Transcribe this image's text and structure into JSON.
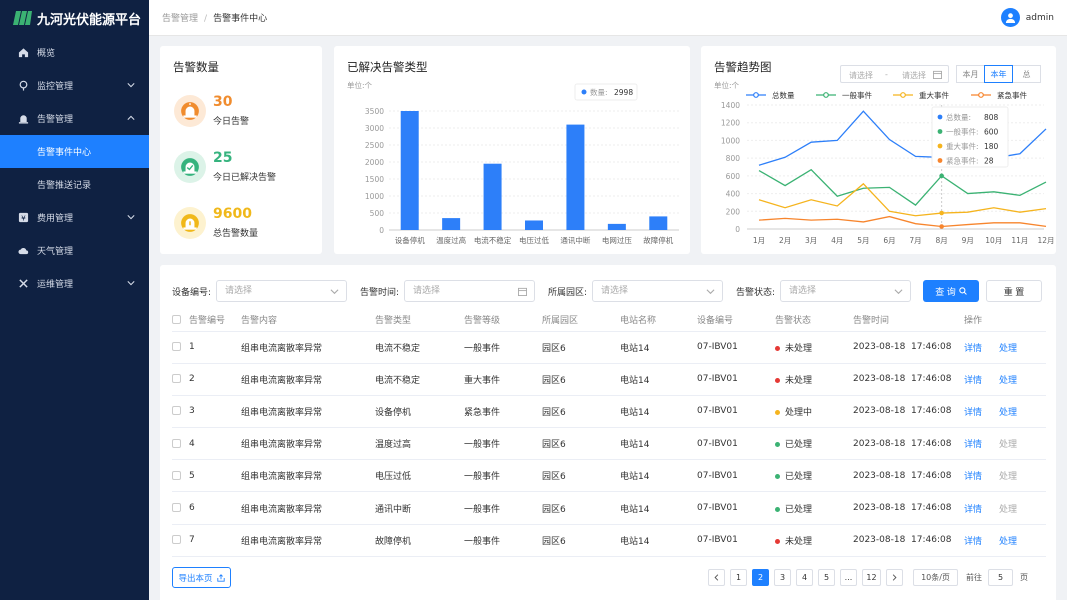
{
  "app": {
    "title": "九河光伏能源平台"
  },
  "sidebar": {
    "items": [
      {
        "label": "概览",
        "icon": "home-icon"
      },
      {
        "label": "监控管理",
        "icon": "monitor-icon",
        "expanded": false
      },
      {
        "label": "告警管理",
        "icon": "alarm-icon",
        "expanded": true
      },
      {
        "label": "告警事件中心",
        "sub": true,
        "active": true
      },
      {
        "label": "告警推送记录",
        "sub": true
      },
      {
        "label": "费用管理",
        "icon": "yen-icon",
        "expanded": false
      },
      {
        "label": "天气管理",
        "icon": "cloud-icon"
      },
      {
        "label": "运维管理",
        "icon": "tools-icon",
        "expanded": false
      }
    ]
  },
  "header": {
    "breadcrumb": [
      "告警管理",
      "告警事件中心"
    ],
    "user": "admin"
  },
  "stats_card": {
    "title": "告警数量",
    "items": [
      {
        "value": "30",
        "label": "今日告警",
        "color": "#f08c2e",
        "bg": "#fde9d6"
      },
      {
        "value": "25",
        "label": "今日已解决告警",
        "color": "#36b37e",
        "bg": "#dcf3e8"
      },
      {
        "value": "9600",
        "label": "总告警数量",
        "color": "#f0b81a",
        "bg": "#fdf2cf"
      }
    ]
  },
  "bar_card": {
    "title": "已解决告警类型",
    "unit": "单位:个",
    "tooltip": {
      "label": "数量:",
      "value": "2998"
    }
  },
  "line_card": {
    "title": "告警趋势图",
    "unit": "单位:个",
    "date_start": "请选择",
    "date_sep": "-",
    "date_end": "请选择",
    "tabs": [
      {
        "label": "本月"
      },
      {
        "label": "本年",
        "active": true
      },
      {
        "label": "总"
      }
    ],
    "tooltip": [
      {
        "label": "总数量:",
        "value": "808",
        "color": "#2d7ff9"
      },
      {
        "label": "一般事件:",
        "value": "600",
        "color": "#3bb273"
      },
      {
        "label": "重大事件:",
        "value": "180",
        "color": "#f5b41e"
      },
      {
        "label": "紧急事件:",
        "value": "28",
        "color": "#f7852d"
      }
    ]
  },
  "chart_data": [
    {
      "type": "bar",
      "title": "已解决告警类型",
      "ylabel": "单位:个",
      "categories": [
        "设备停机",
        "温度过高",
        "电流不稳定",
        "电压过低",
        "通讯中断",
        "电网过压",
        "故障停机"
      ],
      "values": [
        3500,
        350,
        1950,
        280,
        3100,
        180,
        400
      ],
      "ylim": [
        0,
        4000
      ],
      "yticks": [
        0,
        500,
        1000,
        1500,
        2000,
        2500,
        3000,
        3500
      ],
      "color": "#2d7ff9"
    },
    {
      "type": "line",
      "title": "告警趋势图",
      "ylabel": "单位:个",
      "categories": [
        "1月",
        "2月",
        "3月",
        "4月",
        "5月",
        "6月",
        "7月",
        "8月",
        "9月",
        "10月",
        "11月",
        "12月"
      ],
      "ylim": [
        0,
        1400
      ],
      "yticks": [
        0,
        200,
        400,
        600,
        800,
        1000,
        1200,
        1400
      ],
      "legend": "top",
      "series": [
        {
          "name": "总数量",
          "color": "#2d7ff9",
          "values": [
            720,
            810,
            980,
            1000,
            1330,
            1010,
            820,
            808,
            1100,
            800,
            850,
            1130
          ]
        },
        {
          "name": "一般事件",
          "color": "#3bb273",
          "values": [
            660,
            490,
            670,
            370,
            460,
            470,
            270,
            600,
            400,
            420,
            380,
            530
          ]
        },
        {
          "name": "重大事件",
          "color": "#f5b41e",
          "values": [
            330,
            240,
            330,
            260,
            510,
            200,
            150,
            180,
            190,
            240,
            190,
            230
          ]
        },
        {
          "name": "紧急事件",
          "color": "#f7852d",
          "values": [
            100,
            120,
            100,
            110,
            80,
            140,
            60,
            28,
            50,
            70,
            70,
            30
          ]
        }
      ]
    }
  ],
  "filters": {
    "device_label": "设备编号:",
    "device_placeholder": "请选择",
    "time_label": "告警时间:",
    "time_placeholder": "请选择",
    "park_label": "所属园区:",
    "park_placeholder": "请选择",
    "status_label": "告警状态:",
    "status_placeholder": "请选择",
    "query_label": "查 询",
    "reset_label": "重 置"
  },
  "table": {
    "columns": [
      "告警编号",
      "告警内容",
      "告警类型",
      "告警等级",
      "所属园区",
      "电站名称",
      "设备编号",
      "告警状态",
      "告警时间",
      "操作"
    ],
    "detail_label": "详情",
    "handle_label": "处理",
    "rows": [
      {
        "id": "1",
        "content": "组串电流离散率异常",
        "type": "电流不稳定",
        "level": "一般事件",
        "park": "园区6",
        "station": "电站14",
        "device": "07-IBV01",
        "status": "未处理",
        "status_color": "#e53935",
        "time": "2023-08-18  17:46:08",
        "handle_enabled": true
      },
      {
        "id": "2",
        "content": "组串电流离散率异常",
        "type": "电流不稳定",
        "level": "重大事件",
        "park": "园区6",
        "station": "电站14",
        "device": "07-IBV01",
        "status": "未处理",
        "status_color": "#e53935",
        "time": "2023-08-18  17:46:08",
        "handle_enabled": true
      },
      {
        "id": "3",
        "content": "组串电流离散率异常",
        "type": "设备停机",
        "level": "紧急事件",
        "park": "园区6",
        "station": "电站14",
        "device": "07-IBV01",
        "status": "处理中",
        "status_color": "#f5b41e",
        "time": "2023-08-18  17:46:08",
        "handle_enabled": true
      },
      {
        "id": "4",
        "content": "组串电流离散率异常",
        "type": "温度过高",
        "level": "一般事件",
        "park": "园区6",
        "station": "电站14",
        "device": "07-IBV01",
        "status": "已处理",
        "status_color": "#3bb273",
        "time": "2023-08-18  17:46:08",
        "handle_enabled": false
      },
      {
        "id": "5",
        "content": "组串电流离散率异常",
        "type": "电压过低",
        "level": "一般事件",
        "park": "园区6",
        "station": "电站14",
        "device": "07-IBV01",
        "status": "已处理",
        "status_color": "#3bb273",
        "time": "2023-08-18  17:46:08",
        "handle_enabled": false
      },
      {
        "id": "6",
        "content": "组串电流离散率异常",
        "type": "通讯中断",
        "level": "一般事件",
        "park": "园区6",
        "station": "电站14",
        "device": "07-IBV01",
        "status": "已处理",
        "status_color": "#3bb273",
        "time": "2023-08-18  17:46:08",
        "handle_enabled": false
      },
      {
        "id": "7",
        "content": "组串电流离散率异常",
        "type": "故障停机",
        "level": "一般事件",
        "park": "园区6",
        "station": "电站14",
        "device": "07-IBV01",
        "status": "未处理",
        "status_color": "#e53935",
        "time": "2023-08-18  17:46:08",
        "handle_enabled": true
      }
    ]
  },
  "footer": {
    "export_label": "导出本页",
    "pages": [
      "1",
      "2",
      "3",
      "4",
      "5",
      "...",
      "12"
    ],
    "current_page": "2",
    "page_size": "10条/页",
    "goto_label": "前往",
    "goto_value": "5",
    "page_suffix": "页"
  }
}
